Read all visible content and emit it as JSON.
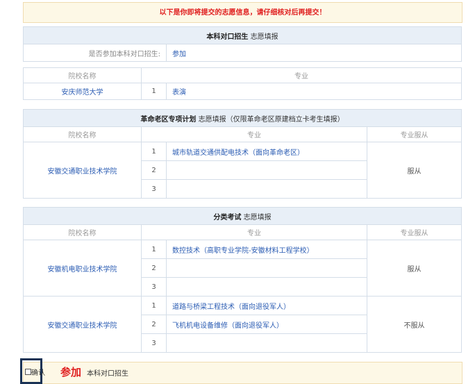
{
  "notice": "以下是你即将提交的志愿信息，请仔细核对后再提交！",
  "section1": {
    "title_bold": "本科对口招生",
    "title_suffix": "志愿填报",
    "participate_label": "是否参加本科对口招生:",
    "participate_value": "参加",
    "col_school": "院校名称",
    "col_major": "专业",
    "rows": [
      {
        "school": "安庆师范大学",
        "num": "1",
        "major": "表演"
      }
    ]
  },
  "section2": {
    "title_bold": "革命老区专项计划",
    "title_suffix": "志愿填报（仅限革命老区原建档立卡考生填报）",
    "col_school": "院校名称",
    "col_major": "专业",
    "col_obey": "专业服从",
    "school": "安徽交通职业技术学院",
    "obey": "服从",
    "majors": [
      {
        "num": "1",
        "major": "城市轨道交通供配电技术（面向革命老区）"
      },
      {
        "num": "2",
        "major": ""
      },
      {
        "num": "3",
        "major": ""
      }
    ]
  },
  "section3": {
    "title_bold": "分类考试",
    "title_suffix": "志愿填报",
    "col_school": "院校名称",
    "col_major": "专业",
    "col_obey": "专业服从",
    "groups": [
      {
        "school": "安徽机电职业技术学院",
        "obey": "服从",
        "majors": [
          {
            "num": "1",
            "major": "数控技术（高职专业学院-安徽材料工程学校）"
          },
          {
            "num": "2",
            "major": ""
          },
          {
            "num": "3",
            "major": ""
          }
        ]
      },
      {
        "school": "安徽交通职业技术学院",
        "obey": "不服从",
        "majors": [
          {
            "num": "1",
            "major": "道路与桥梁工程技术（面向退役军人）"
          },
          {
            "num": "2",
            "major": "飞机机电设备维修（面向退役军人）"
          },
          {
            "num": "3",
            "major": ""
          }
        ]
      }
    ]
  },
  "confirm": {
    "checkbox_label": "确认",
    "join": "参加",
    "desc": "本科对口招生"
  }
}
